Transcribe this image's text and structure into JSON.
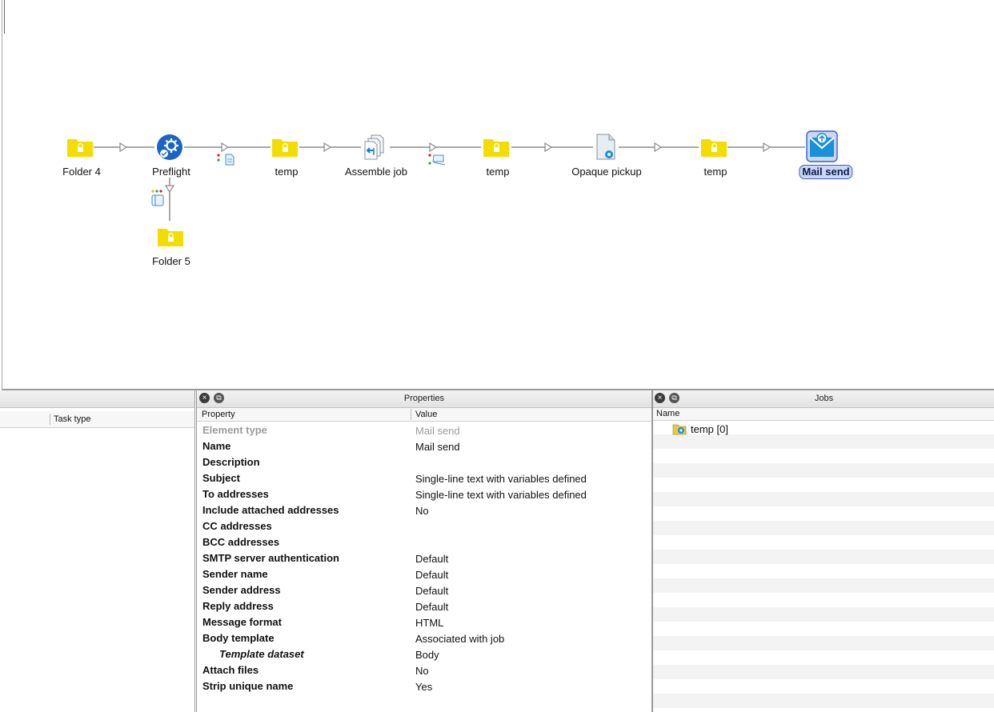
{
  "flow": {
    "nodes": [
      {
        "id": "folder4",
        "label": "Folder 4",
        "icon": "locked-folder-icon"
      },
      {
        "id": "preflight",
        "label": "Preflight",
        "icon": "preflight-gear-icon"
      },
      {
        "id": "temp1",
        "label": "temp",
        "icon": "locked-folder-icon"
      },
      {
        "id": "assemble",
        "label": "Assemble job",
        "icon": "assemble-job-icon"
      },
      {
        "id": "temp2",
        "label": "temp",
        "icon": "locked-folder-icon"
      },
      {
        "id": "opaque",
        "label": "Opaque pickup",
        "icon": "opaque-pickup-icon"
      },
      {
        "id": "temp3",
        "label": "temp",
        "icon": "locked-folder-icon"
      },
      {
        "id": "mailsend",
        "label": "Mail send",
        "icon": "mail-send-icon",
        "selected": true
      },
      {
        "id": "folder5",
        "label": "Folder 5",
        "icon": "locked-folder-icon"
      }
    ]
  },
  "tasks": {
    "columns": [
      "",
      "Task type"
    ]
  },
  "properties": {
    "title": "Properties",
    "columns": [
      "Property",
      "Value"
    ],
    "rows": [
      {
        "name": "Element type",
        "value": "Mail send",
        "dim": true
      },
      {
        "name": "Name",
        "value": "Mail send"
      },
      {
        "name": "Description",
        "value": ""
      },
      {
        "name": "Subject",
        "value": "Single-line text with variables defined"
      },
      {
        "name": "To addresses",
        "value": "Single-line text with variables defined"
      },
      {
        "name": "Include attached addresses",
        "value": "No"
      },
      {
        "name": "CC addresses",
        "value": ""
      },
      {
        "name": "BCC addresses",
        "value": ""
      },
      {
        "name": "SMTP server authentication",
        "value": "Default"
      },
      {
        "name": "Sender name",
        "value": "Default"
      },
      {
        "name": "Sender address",
        "value": "Default"
      },
      {
        "name": "Reply address",
        "value": "Default"
      },
      {
        "name": "Message format",
        "value": "HTML"
      },
      {
        "name": "Body template",
        "value": "Associated with job"
      },
      {
        "name": "Template dataset",
        "value": "Body",
        "indent": true
      },
      {
        "name": "Attach files",
        "value": "No"
      },
      {
        "name": "Strip unique name",
        "value": "Yes"
      }
    ]
  },
  "jobs": {
    "title": "Jobs",
    "column": "Name",
    "items": [
      {
        "label": "temp [0]",
        "icon": "job-folder-icon"
      }
    ]
  },
  "colors": {
    "folder": "#f2dd00",
    "preflight": "#1b64c3",
    "mail": "#1a90d9",
    "selection": "#c9d6f5"
  }
}
